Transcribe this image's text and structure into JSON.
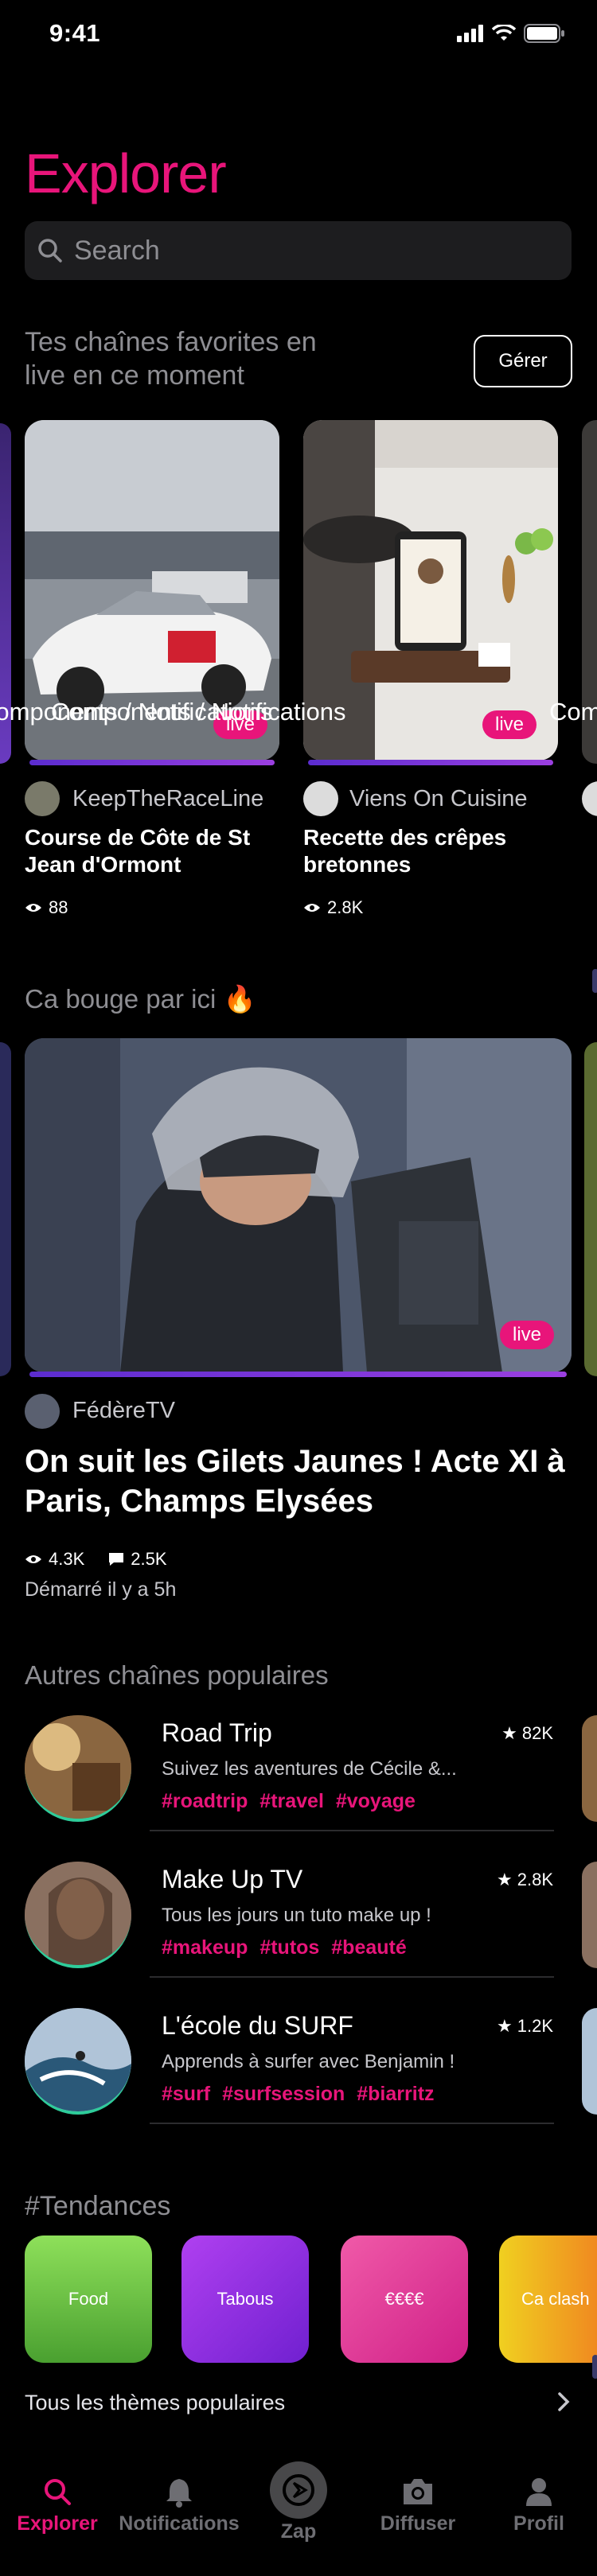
{
  "status": {
    "time": "9:41"
  },
  "header": {
    "title": "Explorer"
  },
  "search": {
    "placeholder": "Search"
  },
  "favorites": {
    "heading": "Tes chaînes favorites en live en ce moment",
    "manage_label": "Gérer",
    "overflow_label": "Components / Notifications",
    "cards": [
      {
        "channel": "KeepTheRaceLine",
        "title": "Course de Côte de St Jean d'Ormont",
        "views": "88",
        "badge": "live"
      },
      {
        "channel": "Viens On Cuisine",
        "title": "Recette des crêpes bretonnes",
        "views": "2.8K",
        "badge": "live"
      }
    ]
  },
  "trending": {
    "heading": "Ca bouge par ici 🔥",
    "badge": "live",
    "channel": "FédèreTV",
    "title": "On suit les Gilets Jaunes ! Acte XI à Paris, Champs Elysées",
    "views": "4.3K",
    "comments": "2.5K",
    "started": "Démarré il y a 5h"
  },
  "popular": {
    "heading": "Autres chaînes populaires",
    "items": [
      {
        "title": "Road Trip",
        "desc": "Suivez les aventures de Cécile &...",
        "tags": "#roadtrip  #travel  #voyage",
        "stars": "82K"
      },
      {
        "title": "Make Up TV",
        "desc": "Tous les jours un tuto make up !",
        "tags": "#makeup #tutos #beauté",
        "stars": "2.8K"
      },
      {
        "title": "L'école du SURF",
        "desc": "Apprends à surfer avec Benjamin !",
        "tags": "#surf #surfsession #biarritz",
        "stars": "1.2K"
      }
    ]
  },
  "trends": {
    "heading": "#Tendances",
    "items": [
      "Food",
      "Tabous",
      "€€€€",
      "Ca clash"
    ],
    "colors": [
      "#6fd04a",
      "#a040f0",
      "#f0409a",
      "#f0b020"
    ],
    "all_themes": "Tous les thèmes populaires"
  },
  "tabbar": {
    "items": [
      "Explorer",
      "Notifications",
      "Zap",
      "Diffuser",
      "Profil"
    ]
  },
  "accent": "#e8157a"
}
